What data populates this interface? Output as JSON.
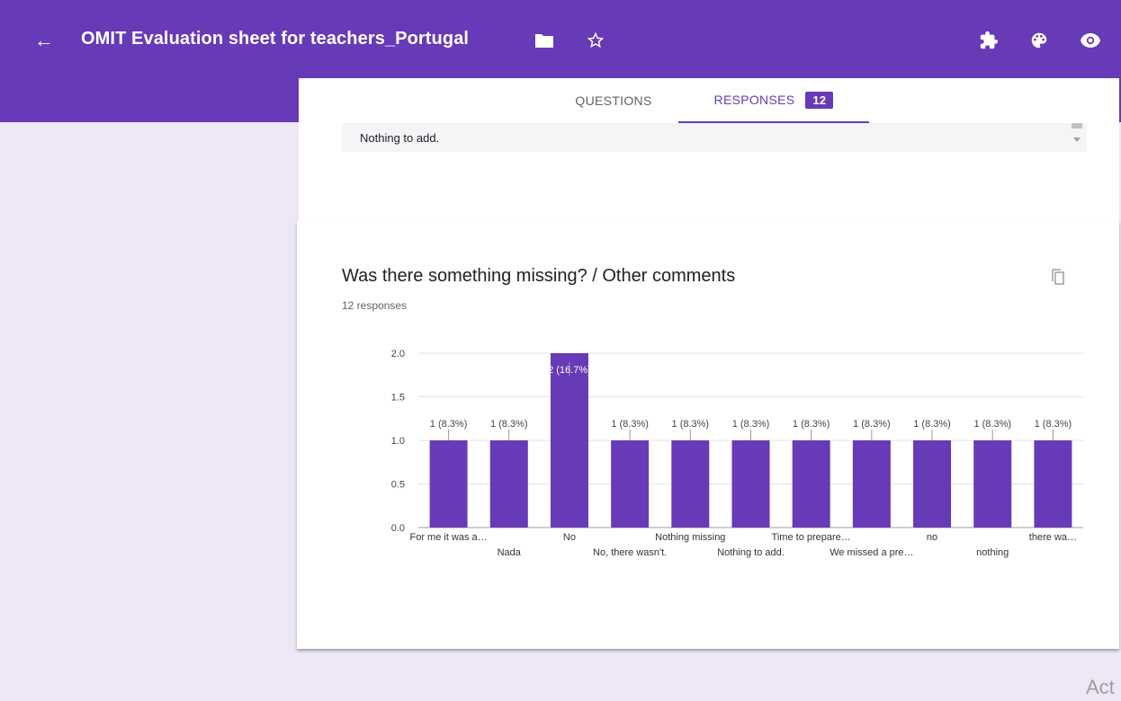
{
  "header": {
    "back_icon": "arrow-back-icon",
    "title": "OMIT Evaluation sheet for teachers_Portugal",
    "folder_icon": "folder-icon",
    "star_icon": "star-outline-icon",
    "addons_icon": "puzzle-icon",
    "palette_icon": "palette-icon",
    "preview_icon": "eye-icon",
    "bg_color": "#673ab7"
  },
  "tabs": {
    "questions": "QUESTIONS",
    "responses": "RESPONSES",
    "responses_count": "12"
  },
  "previous_answer": {
    "text": "Nothing to add."
  },
  "question": {
    "title": "Was there something missing? / Other comments",
    "count": "12 responses",
    "copy_icon": "copy-icon"
  },
  "chart_data": {
    "type": "bar",
    "color": "#673ab7",
    "ylim": [
      0,
      2
    ],
    "yticks": [
      "0.0",
      "0.5",
      "1.0",
      "1.5",
      "2.0"
    ],
    "grid": true,
    "categories": [
      "For me it was a…",
      "Nada",
      "No",
      "No, there wasn't.",
      "Nothing missing",
      "Nothing to add.",
      "Time to prepare…",
      "We missed a pre…",
      "no",
      "nothing",
      "there wa…"
    ],
    "values": [
      1,
      1,
      2,
      1,
      1,
      1,
      1,
      1,
      1,
      1,
      1
    ],
    "labels": [
      "1 (8.3%)",
      "1 (8.3%)",
      "2 (16.7%)",
      "1 (8.3%)",
      "1 (8.3%)",
      "1 (8.3%)",
      "1 (8.3%)",
      "1 (8.3%)",
      "1 (8.3%)",
      "1 (8.3%)",
      "1 (8.3%)"
    ]
  },
  "watermark": "Act"
}
